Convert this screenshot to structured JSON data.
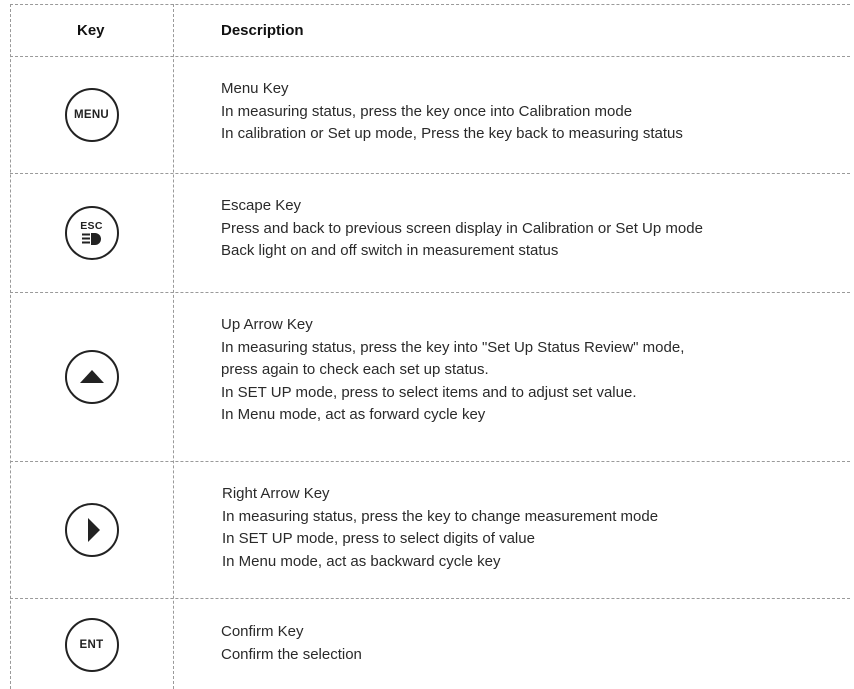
{
  "header": {
    "key": "Key",
    "description": "Description"
  },
  "rows": [
    {
      "key_label": "MENU",
      "icon": "menu-key-icon",
      "lines": [
        "Menu Key",
        "In measuring status, press the key once into Calibration mode",
        "In calibration or Set up mode, Press the key back to measuring status"
      ]
    },
    {
      "key_label": "ESC",
      "icon": "esc-backlight-key-icon",
      "lines": [
        "Escape Key",
        "Press and back to previous screen display in Calibration or Set Up mode",
        "Back light on and off switch in measurement status"
      ]
    },
    {
      "key_label": "",
      "icon": "up-arrow-icon",
      "lines": [
        "Up Arrow Key",
        "In measuring status, press the key into \"Set Up Status Review\" mode,",
        "press again to check each set up status.",
        "In SET UP mode, press to select items and to adjust set value.",
        "In Menu mode, act as forward cycle key"
      ]
    },
    {
      "key_label": "",
      "icon": "right-arrow-icon",
      "lines": [
        "Right Arrow Key",
        "In measuring status, press the key to change measurement mode",
        "In SET UP mode, press to select digits of value",
        "In Menu mode, act as backward cycle key"
      ]
    },
    {
      "key_label": "ENT",
      "icon": "enter-key-icon",
      "lines": [
        "Confirm Key",
        "Confirm the selection"
      ]
    }
  ]
}
